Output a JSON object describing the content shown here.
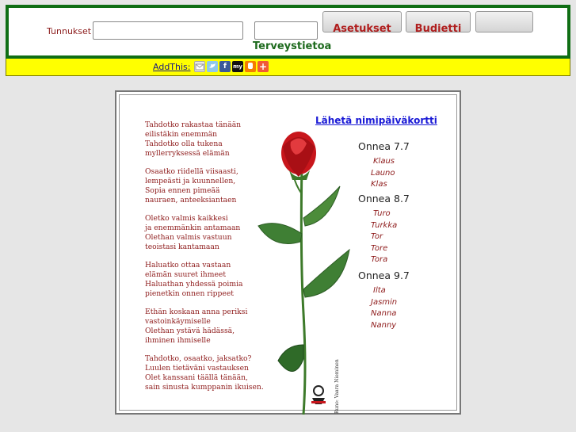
{
  "header": {
    "login_label": "Tunnukset",
    "username_value": "",
    "password_value": "",
    "settings_button": "Asetukset",
    "budget_button": "Budjetti",
    "blank_button": "",
    "health_link": "Terveystietoa"
  },
  "share": {
    "label": "AddThis:",
    "icons": [
      "email-icon",
      "twitter-icon",
      "facebook-icon",
      "myspace-icon",
      "blogger-icon",
      "more-share-icon"
    ],
    "myspace_text": "my"
  },
  "card": {
    "send_link": "Lähetä nimipäiväkortti",
    "poem": [
      [
        "Tahdotko rakastaa tänään",
        "eilistäkin enemmän",
        "Tahdotko olla tukena",
        "myllerryksessä elämän"
      ],
      [
        "Osaatko riidellä viisaasti,",
        "lempeästi ja kuunnellen,",
        "Sopia ennen pimeää",
        "nauraen, anteeksiantaen"
      ],
      [
        "Oletko valmis kaikkesi",
        "ja enemmänkin antamaan",
        "Olethan valmis vastuun",
        "teoistasi kantamaan"
      ],
      [
        "Haluatko ottaa vastaan",
        "elämän suuret ihmeet",
        "Haluathan yhdessä poimia",
        "pienetkin onnen rippeet"
      ],
      [
        "Ethän koskaan anna periksi",
        "vastoinkäymiselle",
        "Olethan ystävä hädässä,",
        "ihminen ihmiselle"
      ],
      [
        "Tahdotko, osaatko, jaksatko?",
        "Luulen tietäväni vastauksen",
        "Olet kanssani täällä tänään,",
        "sain sinusta kumppanin ikuisen."
      ]
    ],
    "credit": "Runo: Vaara Nieminen",
    "days": [
      {
        "title": "Onnea 7.7",
        "names": [
          "Klaus",
          "Launo",
          "Klas"
        ]
      },
      {
        "title": "Onnea 8.7",
        "names": [
          "Turo",
          "Turkka",
          "Tor",
          "Tore",
          "Tora"
        ]
      },
      {
        "title": "Onnea 9.7",
        "names": [
          "Ilta",
          "Jasmin",
          "Nanna",
          "Nanny"
        ]
      }
    ]
  }
}
